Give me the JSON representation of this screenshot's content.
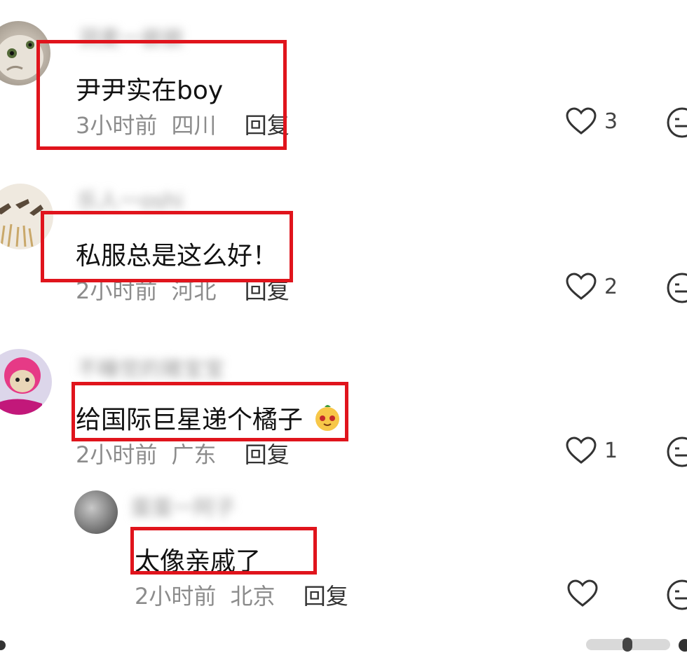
{
  "comments": [
    {
      "username": "洞麦一嵌嵌",
      "text": "尹尹实在boy",
      "time": "3小时前",
      "location": "四川",
      "reply_label": "回复",
      "likes": "3"
    },
    {
      "username": "乐人一oshi",
      "text": "私服总是这么好！",
      "time": "2小时前",
      "location": "河北",
      "reply_label": "回复",
      "likes": "2"
    },
    {
      "username": "不睡觉的猪宝宝",
      "text": "给国际巨星递个橘子",
      "time": "2小时前",
      "location": "广东",
      "reply_label": "回复",
      "likes": "1"
    }
  ],
  "reply": {
    "username": "蛋蛋一阿子",
    "text": "太像亲戚了",
    "time": "2小时前",
    "location": "北京",
    "reply_label": "回复",
    "likes": ""
  },
  "colors": {
    "highlight_box": "#e0141c",
    "meta_text": "#8c8c8c"
  }
}
